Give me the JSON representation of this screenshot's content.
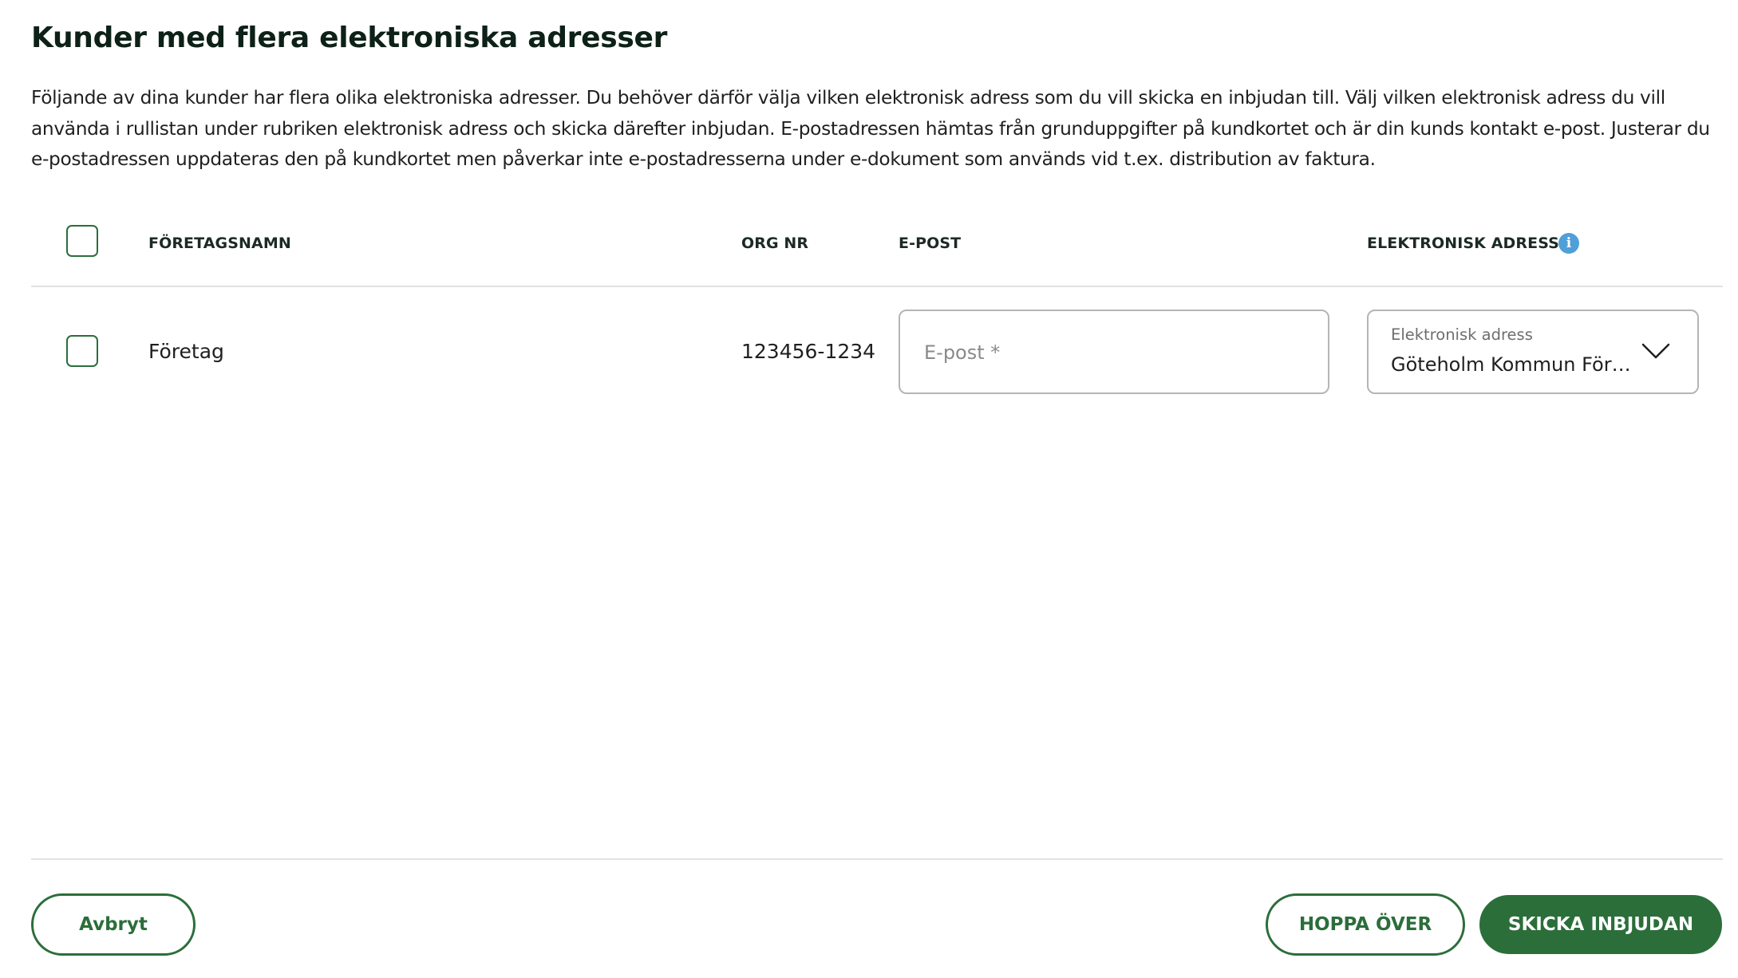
{
  "page": {
    "title": "Kunder med flera elektroniska adresser",
    "description": "Följande av dina kunder har flera olika elektroniska adresser. Du behöver därför välja vilken elektronisk adress som du vill skicka en inbjudan till. Välj vilken elektronisk adress du vill använda i rullistan under rubriken elektronisk adress och skicka därefter inbjudan. E-postadressen hämtas från grunduppgifter på kundkortet och är din kunds kontakt e-post. Justerar du e-postadressen uppdateras den på kundkortet men påverkar inte e-postadresserna under e-dokument som används vid t.ex. distribution av faktura."
  },
  "table": {
    "columns": {
      "company_name": "FÖRETAGSNAMN",
      "org_nr": "ORG NR",
      "email": "E-POST",
      "electronic_address": "ELEKTRONISK ADRESS"
    },
    "info_icon": "info-icon",
    "rows": [
      {
        "company_name": "Företag",
        "org_nr": "123456-1234",
        "email_value": "",
        "email_placeholder": "E-post *",
        "address_label": "Elektronisk adress",
        "address_value": "Göteholm Kommun Förvaltning"
      }
    ]
  },
  "footer": {
    "cancel_label": "Avbryt",
    "skip_label": "HOPPA ÖVER",
    "send_label": "SKICKA INBJUDAN"
  },
  "colors": {
    "accent": "#2b6e3a",
    "info": "#4f9fd9",
    "divider": "#e2e2e2",
    "field_border": "#b5b5b5"
  }
}
